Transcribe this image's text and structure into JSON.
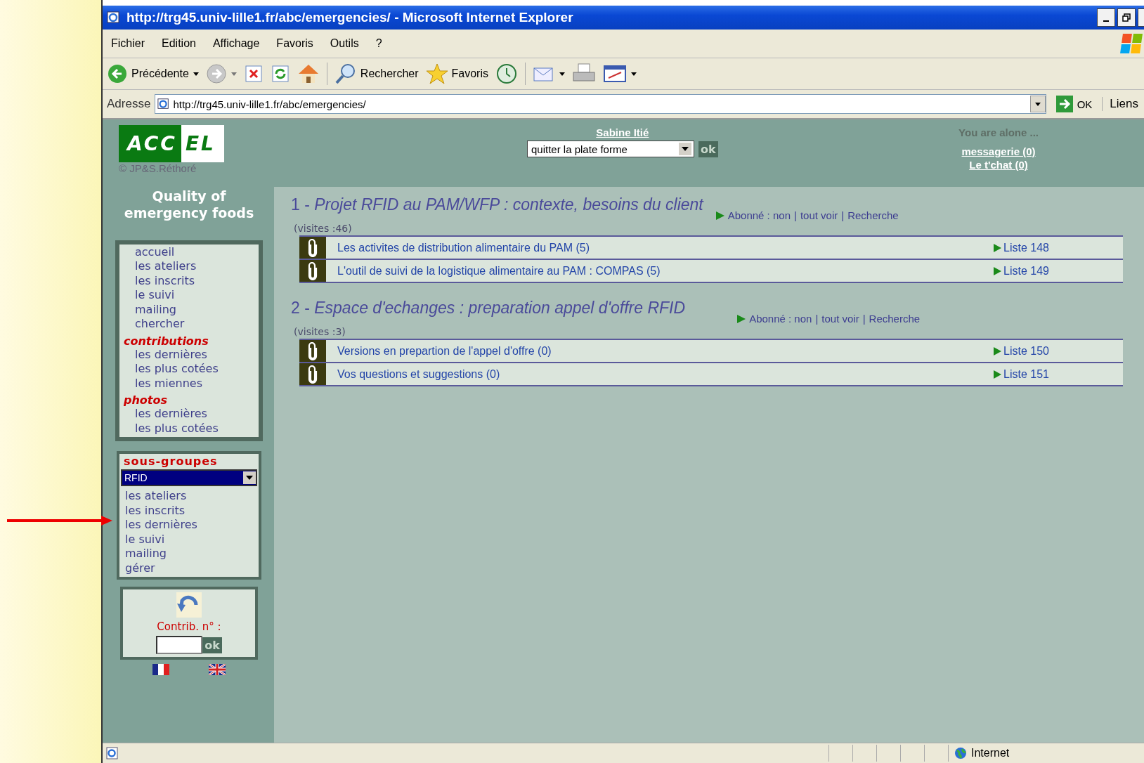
{
  "window": {
    "title": "http://trg45.univ-lille1.fr/abc/emergencies/ - Microsoft Internet Explorer"
  },
  "menu": [
    "Fichier",
    "Edition",
    "Affichage",
    "Favoris",
    "Outils",
    "?"
  ],
  "toolbar": {
    "back": "Précédente",
    "search": "Rechercher",
    "favorites": "Favoris"
  },
  "address": {
    "label": "Adresse",
    "value": "http://trg45.univ-lille1.fr/abc/emergencies/",
    "go": "OK",
    "links": "Liens"
  },
  "header": {
    "logo_left": "ACC",
    "logo_right": "EL",
    "copyright": "© JP&S.Réthoré",
    "user": "Sabine Itié",
    "action_select": "quitter la plate forme",
    "action_ok": "ok",
    "presence": "You are alone ...",
    "messages": "messagerie (0)",
    "chat": "Le t'chat (0)"
  },
  "sidebar": {
    "title": "Quality of emergency foods",
    "items": [
      {
        "kind": "link",
        "label": "accueil"
      },
      {
        "kind": "link",
        "label": "les ateliers"
      },
      {
        "kind": "link",
        "label": "les inscrits"
      },
      {
        "kind": "link",
        "label": "le suivi"
      },
      {
        "kind": "link",
        "label": "mailing"
      },
      {
        "kind": "link",
        "label": "chercher"
      },
      {
        "kind": "heading",
        "label": "contributions"
      },
      {
        "kind": "link",
        "label": "les dernières"
      },
      {
        "kind": "link",
        "label": "les plus cotées"
      },
      {
        "kind": "link",
        "label": "les miennes"
      },
      {
        "kind": "heading",
        "label": "photos"
      },
      {
        "kind": "link",
        "label": "les dernières"
      },
      {
        "kind": "link",
        "label": "les plus cotées"
      }
    ],
    "subgroups": {
      "title": "sous-groupes",
      "select": "RFID",
      "items": [
        "les ateliers",
        "les inscrits",
        "les dernières",
        "le suivi",
        "mailing",
        "gérer"
      ]
    },
    "contrib": {
      "label": "Contrib. n° :",
      "ok": "ok"
    }
  },
  "topics": [
    {
      "title": "1 - *Projet RFID au PAM/WFP : contexte, besoins du client*",
      "visits": "(visites :46)",
      "subscribed": "Abonné : non",
      "separator": "|",
      "see_all": "tout voir",
      "search": "Recherche",
      "rows": [
        {
          "title": "Les activites de distribution alimentaire du PAM (5)",
          "list": "Liste 148"
        },
        {
          "title": "L'outil de suivi de la logistique alimentaire au PAM : COMPAS (5)",
          "list": "Liste 149"
        }
      ]
    },
    {
      "title": "2 - *Espace d'echanges : preparation appel d'offre RFID*",
      "visits": "(visites :3)",
      "subscribed": "Abonné : non",
      "separator": "|",
      "see_all": "tout voir",
      "search": "Recherche",
      "rows": [
        {
          "title": "Versions en prepartion de l'appel d'offre (0)",
          "list": "Liste 150"
        },
        {
          "title": "Vos questions et suggestions (0)",
          "list": "Liste 151"
        }
      ]
    }
  ],
  "status_bar": {
    "zone": "Internet"
  }
}
